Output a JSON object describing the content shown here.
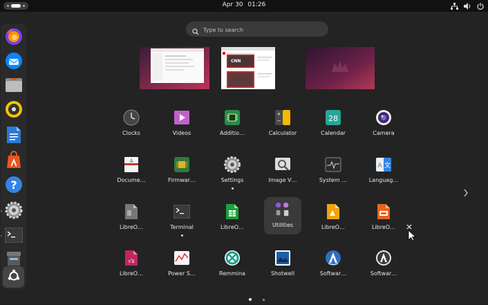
{
  "topbar": {
    "date": "Apr 30",
    "time": "01:26",
    "tray_icons": [
      "network-icon",
      "volume-icon",
      "power-icon"
    ]
  },
  "search": {
    "placeholder": "Type to search",
    "value": ""
  },
  "dock": {
    "items": [
      {
        "name": "firefox",
        "icon": "firefox-icon"
      },
      {
        "name": "thunderbird",
        "icon": "thunderbird-icon"
      },
      {
        "name": "files",
        "icon": "files-icon"
      },
      {
        "name": "rhythmbox",
        "icon": "rhythmbox-icon"
      },
      {
        "name": "libreoffice-writer",
        "icon": "writer-icon"
      },
      {
        "name": "app-center",
        "icon": "app-center-icon"
      },
      {
        "name": "help",
        "icon": "help-icon"
      },
      {
        "name": "settings",
        "icon": "settings-icon"
      },
      {
        "name": "terminal",
        "icon": "terminal-icon"
      },
      {
        "name": "trash",
        "icon": "trash-icon"
      },
      {
        "name": "show-apps",
        "icon": "ubuntu-icon"
      }
    ]
  },
  "workspaces": [
    {
      "name": "workspace-1"
    },
    {
      "name": "workspace-2",
      "thumbnail_text": "CNN"
    },
    {
      "name": "workspace-3"
    }
  ],
  "apps": {
    "row1": [
      {
        "label": "Clocks",
        "icon": "clock-icon"
      },
      {
        "label": "Videos",
        "icon": "videos-icon"
      },
      {
        "label": "Additio…",
        "icon": "additional-drivers-icon"
      },
      {
        "label": "Calculator",
        "icon": "calculator-icon"
      },
      {
        "label": "Calendar",
        "icon": "calendar-icon",
        "badge": "28"
      },
      {
        "label": "Camera",
        "icon": "camera-icon"
      }
    ],
    "row2": [
      {
        "label": "Docume…",
        "icon": "document-viewer-icon"
      },
      {
        "label": "Firmwar…",
        "icon": "firmware-icon"
      },
      {
        "label": "Settings",
        "icon": "settings-icon",
        "running": true
      },
      {
        "label": "Image V…",
        "icon": "image-viewer-icon"
      },
      {
        "label": "System …",
        "icon": "system-monitor-icon"
      },
      {
        "label": "Languag…",
        "icon": "language-icon"
      }
    ],
    "row3": [
      {
        "label": "LibreO…",
        "icon": "libreoffice-icon"
      },
      {
        "label": "Terminal",
        "icon": "terminal-icon",
        "running": true
      },
      {
        "label": "LibreO…",
        "icon": "libreoffice-calc-icon"
      },
      {
        "label": "Utilities",
        "icon": "utilities-folder-icon"
      },
      {
        "label": "LibreO…",
        "icon": "libreoffice-draw-icon"
      },
      {
        "label": "LibreO…",
        "icon": "libreoffice-impress-icon"
      }
    ],
    "row4": [
      {
        "label": "LibreO…",
        "icon": "libreoffice-math-icon"
      },
      {
        "label": "Power S…",
        "icon": "power-statistics-icon"
      },
      {
        "label": "Remmina",
        "icon": "remmina-icon"
      },
      {
        "label": "Shotwell",
        "icon": "shotwell-icon"
      },
      {
        "label": "Softwar…",
        "icon": "software-updater-icon"
      },
      {
        "label": "Softwar…",
        "icon": "software-properties-icon"
      }
    ]
  },
  "pager": {
    "current": 1,
    "total": 2
  },
  "colors": {
    "accent": "#e95420",
    "background": "#232323",
    "topbar": "#111111"
  }
}
